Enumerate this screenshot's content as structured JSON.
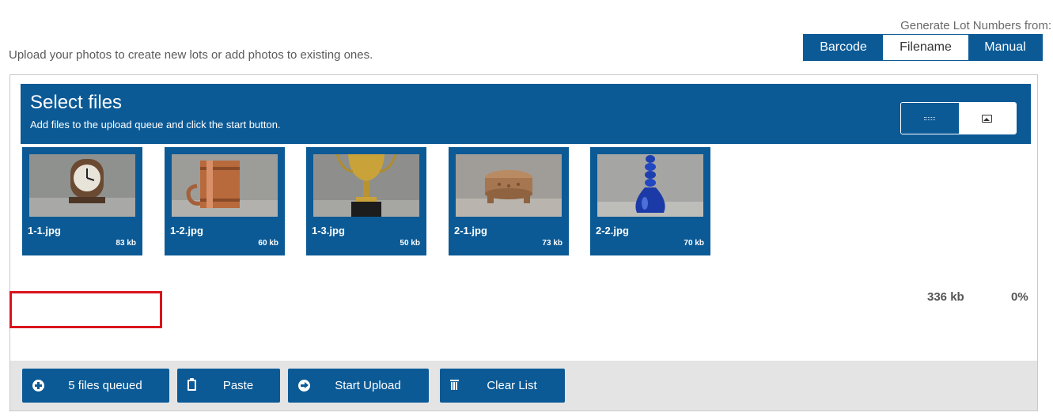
{
  "intro_text": "Upload your photos to create new lots or add photos to existing ones.",
  "lot_numbers": {
    "label": "Generate Lot Numbers from:",
    "options": [
      "Barcode",
      "Filename",
      "Manual"
    ]
  },
  "uploader": {
    "title": "Select files",
    "subtitle": "Add files to the upload queue and click the start button.",
    "view_icons": [
      "list-view-icon",
      "thumbnail-view-icon"
    ],
    "files": [
      {
        "name": "1-1.jpg",
        "size": "83 kb"
      },
      {
        "name": "1-2.jpg",
        "size": "60 kb"
      },
      {
        "name": "1-3.jpg",
        "size": "50 kb"
      },
      {
        "name": "2-1.jpg",
        "size": "73 kb"
      },
      {
        "name": "2-2.jpg",
        "size": "70 kb"
      }
    ],
    "buttons": {
      "queued": "5 files queued",
      "paste": "Paste",
      "start": "Start Upload",
      "clear": "Clear List"
    },
    "total_size": "336 kb",
    "progress": "0%"
  },
  "colors": {
    "primary": "#0b5a96",
    "highlight": "#d9141c",
    "footer_bg": "#e4e4e4"
  }
}
